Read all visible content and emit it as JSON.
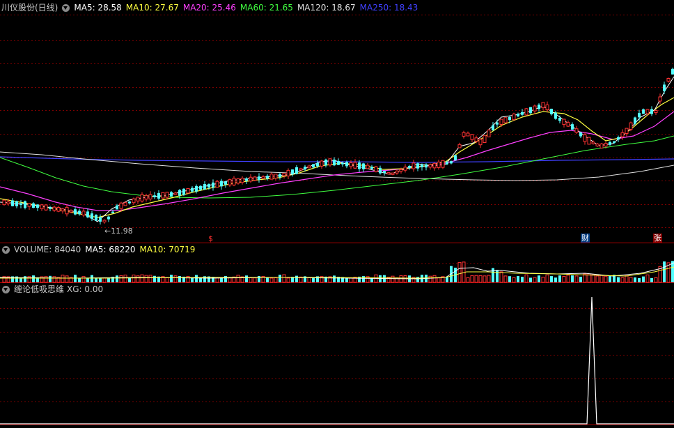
{
  "main": {
    "title": "川仪股份(日线)",
    "ma": [
      {
        "label": "MA5: 28.58",
        "color": "#ffffff"
      },
      {
        "label": "MA10: 27.67",
        "color": "#ffff40"
      },
      {
        "label": "MA20: 25.46",
        "color": "#ff40ff"
      },
      {
        "label": "MA60: 21.65",
        "color": "#40ff40"
      },
      {
        "label": "MA120: 18.67",
        "color": "#e0e0e0"
      },
      {
        "label": "MA250: 18.43",
        "color": "#4040ff"
      }
    ],
    "low_label": "11.98",
    "markers": {
      "s": "$",
      "cai": "财",
      "zhang": "张"
    }
  },
  "volume": {
    "label": "VOLUME: 84040",
    "ma5": "MA5: 68220",
    "ma10": "MA10: 70719"
  },
  "indicator": {
    "name": "缠论低吸思维",
    "xg": "XG: 0.00"
  },
  "colors": {
    "up": "#ff3232",
    "down": "#54ffff",
    "grid": "#7a0000",
    "border": "#b00000"
  }
}
